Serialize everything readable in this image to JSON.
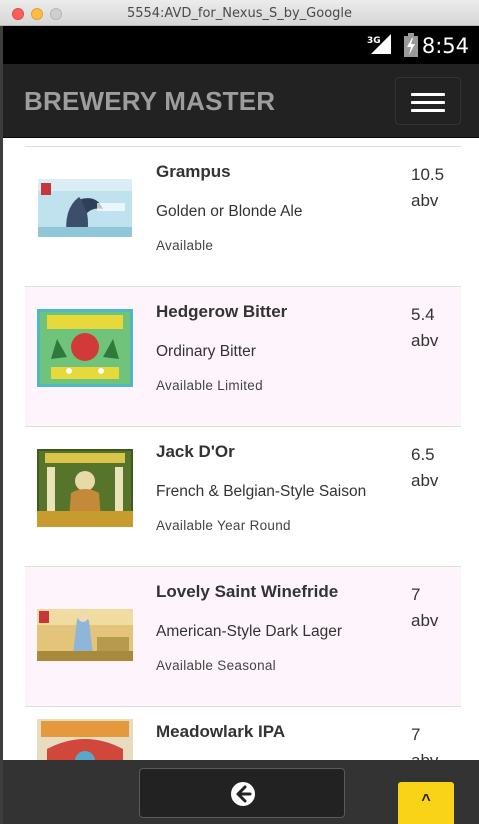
{
  "window": {
    "title": "5554:AVD_for_Nexus_S_by_Google"
  },
  "status_bar": {
    "network": "3G",
    "time": "8:54"
  },
  "navbar": {
    "brand": "BREWERY MASTER",
    "menu_icon": "hamburger-menu-icon"
  },
  "beers": [
    {
      "name": "Grampus",
      "style": "Golden or Blonde Ale",
      "availability": "Available",
      "abv_value": "10.5",
      "abv_unit": "abv"
    },
    {
      "name": "Hedgerow Bitter",
      "style": "Ordinary Bitter",
      "availability": "Available Limited",
      "abv_value": "5.4",
      "abv_unit": "abv"
    },
    {
      "name": "Jack D'Or",
      "style": "French & Belgian-Style Saison",
      "availability": "Available Year Round",
      "abv_value": "6.5",
      "abv_unit": "abv"
    },
    {
      "name": "Lovely Saint Winefride",
      "style": "American-Style Dark Lager",
      "availability": "Available Seasonal",
      "abv_value": "7",
      "abv_unit": "abv"
    },
    {
      "name": "Meadowlark IPA",
      "style": "",
      "availability": "",
      "abv_value": "7",
      "abv_unit": "abv"
    }
  ],
  "bottom_bar": {
    "back_icon": "arrow-left-circle-icon",
    "top_icon": "chevron-up-icon",
    "top_glyph": "^"
  },
  "colors": {
    "navbar_bg": "#222222",
    "brand_text": "#9d9d9d",
    "alt_row_bg": "#fdf5fb",
    "top_button": "#f8d318"
  }
}
